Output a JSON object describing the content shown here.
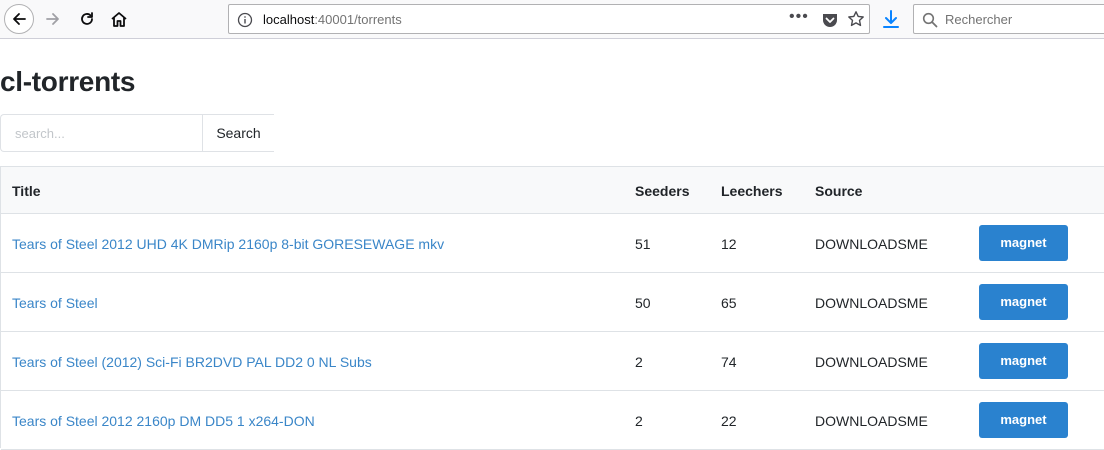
{
  "browser": {
    "url_host": "localhost",
    "url_path": ":40001/torrents",
    "search_placeholder": "Rechercher",
    "url_more": "•••"
  },
  "page": {
    "title": "cl-torrents",
    "search_placeholder": "search...",
    "search_button": "Search"
  },
  "table": {
    "headers": {
      "title": "Title",
      "seeders": "Seeders",
      "leechers": "Leechers",
      "source": "Source"
    },
    "rows": [
      {
        "title": "Tears of Steel 2012 UHD 4K DMRip 2160p 8-bit GORESEWAGE mkv",
        "seeders": "51",
        "leechers": "12",
        "source": "DOWNLOADSME",
        "action": "magnet"
      },
      {
        "title": "Tears of Steel",
        "seeders": "50",
        "leechers": "65",
        "source": "DOWNLOADSME",
        "action": "magnet"
      },
      {
        "title": "Tears of Steel (2012) Sci-Fi BR2DVD PAL DD2 0 NL Subs",
        "seeders": "2",
        "leechers": "74",
        "source": "DOWNLOADSME",
        "action": "magnet"
      },
      {
        "title": "Tears of Steel 2012 2160p DM DD5 1 x264-DON",
        "seeders": "2",
        "leechers": "22",
        "source": "DOWNLOADSME",
        "action": "magnet"
      }
    ]
  },
  "colors": {
    "link": "#3a86c8",
    "button": "#2a82cf",
    "header_bg": "#f8f9fa"
  }
}
